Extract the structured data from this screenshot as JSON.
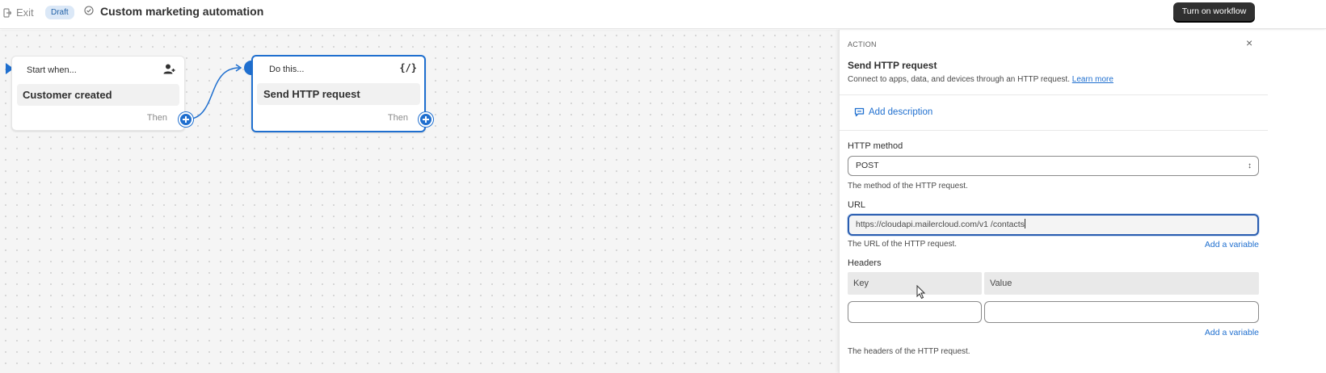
{
  "topbar": {
    "exit_label": "Exit",
    "status_badge": "Draft",
    "title": "Custom marketing automation",
    "turn_on_label": "Turn on workflow"
  },
  "canvas": {
    "nodes": [
      {
        "header": "Start when...",
        "body": "Customer created",
        "then_label": "Then",
        "icon": "person-add-icon"
      },
      {
        "header": "Do this...",
        "body": "Send HTTP request",
        "then_label": "Then",
        "icon": "code-braces-icon",
        "icon_text": "{/}"
      }
    ]
  },
  "panel": {
    "eyebrow": "ACTION",
    "close_glyph": "×",
    "title": "Send HTTP request",
    "description": "Connect to apps, data, and devices through an HTTP request.",
    "learn_more": "Learn more",
    "add_description": "Add description",
    "http_method": {
      "label": "HTTP method",
      "value": "POST",
      "help": "The method of the HTTP request."
    },
    "url": {
      "label": "URL",
      "value": "https://cloudapi.mailercloud.com/v1 /contacts",
      "help": "The URL of the HTTP request.",
      "add_variable": "Add a variable"
    },
    "headers": {
      "label": "Headers",
      "key_header": "Key",
      "value_header": "Value",
      "add_variable": "Add a variable",
      "help": "The headers of the HTTP request."
    }
  },
  "colors": {
    "accent": "#1f6fcf",
    "primary_button": "#303030",
    "badge_bg": "#dbe8f7"
  }
}
